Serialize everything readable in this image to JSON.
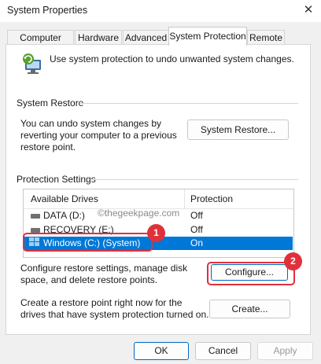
{
  "window": {
    "title": "System Properties",
    "close_symbol": "✕"
  },
  "tabs": [
    {
      "label": "Computer Name",
      "active": false
    },
    {
      "label": "Hardware",
      "active": false
    },
    {
      "label": "Advanced",
      "active": false
    },
    {
      "label": "System Protection",
      "active": true
    },
    {
      "label": "Remote",
      "active": false
    }
  ],
  "intro": {
    "text": "Use system protection to undo unwanted system changes."
  },
  "system_restore": {
    "heading": "System Restore",
    "description": "You can undo system changes by reverting your computer to a previous restore point.",
    "button": "System Restore..."
  },
  "protection": {
    "heading": "Protection Settings",
    "columns": [
      "Available Drives",
      "Protection"
    ],
    "drives": [
      {
        "name": "DATA (D:)",
        "protection": "Off",
        "selected": false
      },
      {
        "name": "RECOVERY (E:)",
        "protection": "Off",
        "selected": false
      },
      {
        "name": "Windows (C:) (System)",
        "protection": "On",
        "selected": true
      }
    ],
    "configure_text": "Configure restore settings, manage disk space, and delete restore points.",
    "configure_button": "Configure...",
    "create_text": "Create a restore point right now for the drives that have system protection turned on.",
    "create_button": "Create..."
  },
  "watermark": "©thegeekpage.com",
  "callouts": [
    "1",
    "2"
  ],
  "footer": {
    "ok": "OK",
    "cancel": "Cancel",
    "apply": "Apply"
  },
  "colors": {
    "selection": "#0078d7",
    "callout": "#e0313b",
    "accent": "#0067c0"
  }
}
